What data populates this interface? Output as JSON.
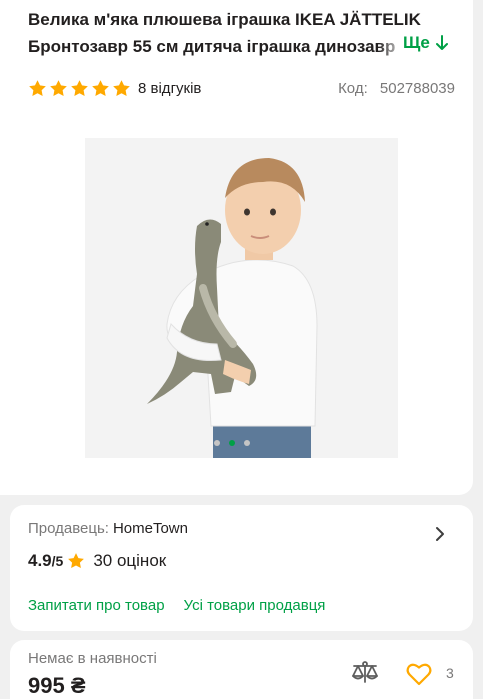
{
  "product": {
    "title_line1": "Велика м'яка плюшева іграшка IKEA JÄTTELIK",
    "title_line2": "Бронтозавр 55 см дитяча іграшка динозавр",
    "more_label": "Ще",
    "rating": 5,
    "reviews_label": "8 відгуків",
    "code_label": "Код:",
    "code_value": "502788039"
  },
  "gallery": {
    "slides_total": 3,
    "active_slide": 2
  },
  "seller": {
    "label": "Продавець:",
    "name": "HomeTown",
    "score": "4.9",
    "score_max": "/5",
    "ratings_count": "30 оцінок",
    "ask_link": "Запитати про товар",
    "all_products_link": "Усі товари продавця"
  },
  "buy": {
    "stock_status": "Немає в наявності",
    "price": "995 ₴",
    "favorites_count": "3"
  },
  "colors": {
    "accent_green": "#00a046",
    "star_yellow": "#ffa900",
    "text_dark": "#221f1f",
    "text_gray": "#797878"
  },
  "icons": {
    "more": "arrow-down-icon",
    "star": "star-icon",
    "seller_chevron": "chevron-right-icon",
    "compare": "scales-icon",
    "favorite": "heart-icon"
  }
}
